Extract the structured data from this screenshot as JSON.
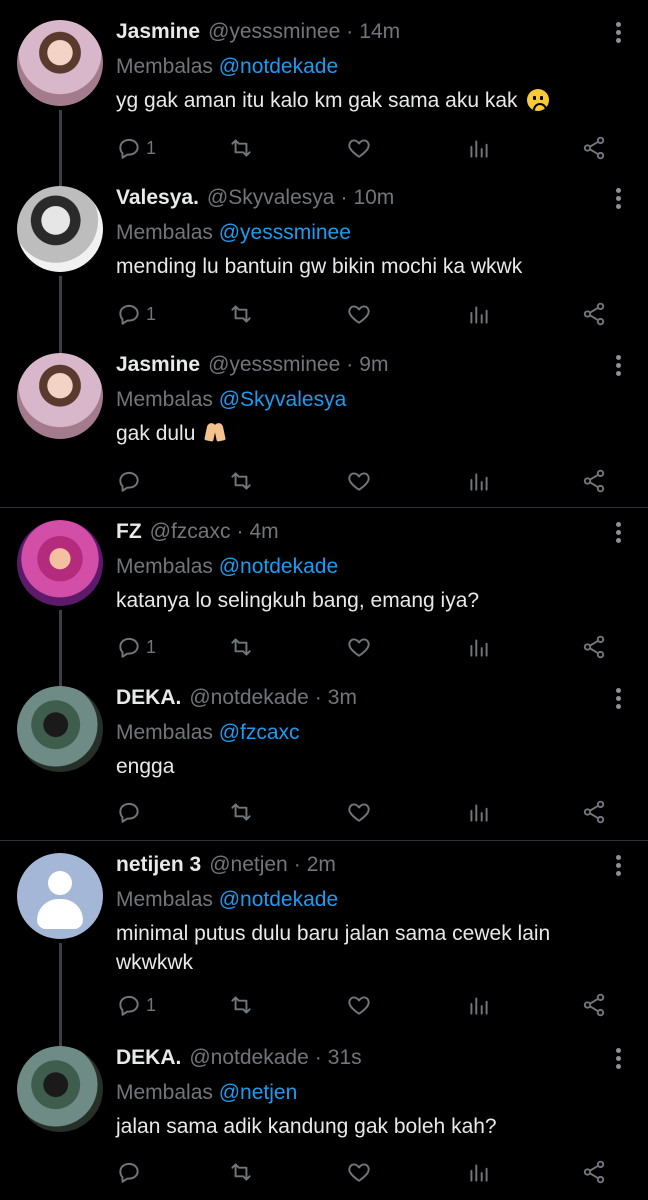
{
  "reply_prefix": "Membalas",
  "tweets": [
    {
      "name": "Jasmine",
      "handle": "@yesssminee",
      "time": "14m",
      "reply_to": "@notdekade",
      "text": "yg gak aman itu kalo km gak sama aku kak",
      "emoji": "frowning-face",
      "replies": "1"
    },
    {
      "name": "Valesya.",
      "handle": "@Skyvalesya",
      "time": "10m",
      "reply_to": "@yesssminee",
      "text": "mending lu bantuin gw bikin mochi ka wkwk",
      "replies": "1"
    },
    {
      "name": "Jasmine",
      "handle": "@yesssminee",
      "time": "9m",
      "reply_to": "@Skyvalesya",
      "text": "gak dulu",
      "emoji": "folded-hands",
      "replies": ""
    },
    {
      "name": "FZ",
      "handle": "@fzcaxc",
      "time": "4m",
      "reply_to": "@notdekade",
      "text": "katanya lo selingkuh bang, emang iya?",
      "replies": "1"
    },
    {
      "name": "DEKA.",
      "handle": "@notdekade",
      "time": "3m",
      "reply_to": "@fzcaxc",
      "text": "engga",
      "replies": ""
    },
    {
      "name": "netijen 3",
      "handle": "@netjen",
      "time": "2m",
      "reply_to": "@notdekade",
      "text": "minimal putus dulu baru jalan sama cewek lain wkwkwk",
      "replies": "1"
    },
    {
      "name": "DEKA.",
      "handle": "@notdekade",
      "time": "31s",
      "reply_to": "@netjen",
      "text": "jalan sama adik kandung gak boleh kah?",
      "replies": ""
    }
  ],
  "colors": {
    "background": "#000000",
    "text": "#e7e9ea",
    "muted": "#71767b",
    "mention": "#1d9bf0",
    "separator": "#2f3336"
  }
}
